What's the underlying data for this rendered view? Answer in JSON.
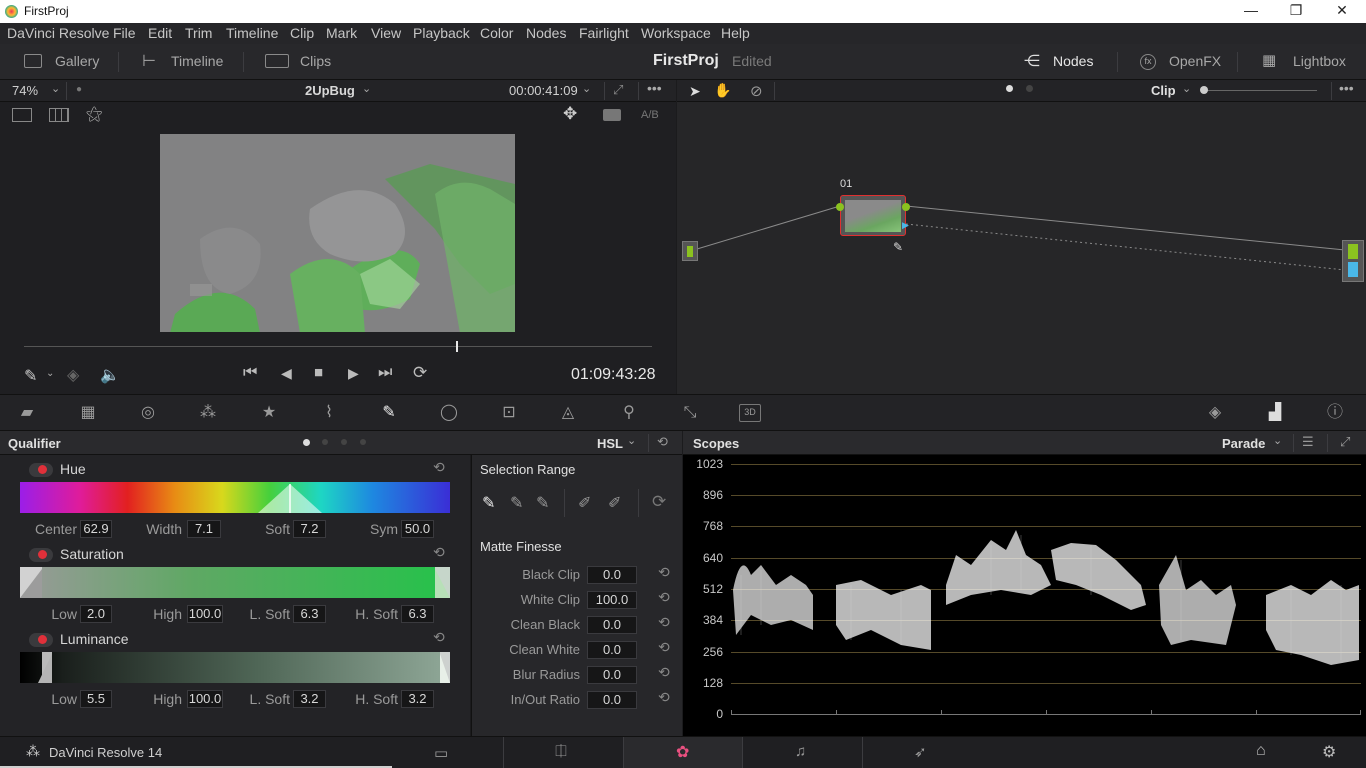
{
  "window": {
    "title": "FirstProj",
    "minimize": "—",
    "restore": "❐",
    "close": "✕"
  },
  "menu": [
    "DaVinci Resolve",
    "File",
    "Edit",
    "Trim",
    "Timeline",
    "Clip",
    "Mark",
    "View",
    "Playback",
    "Color",
    "Nodes",
    "Fairlight",
    "Workspace",
    "Help"
  ],
  "toolbar": {
    "gallery": "Gallery",
    "timeline": "Timeline",
    "clips": "Clips",
    "project": "FirstProj",
    "status": "Edited",
    "nodes": "Nodes",
    "openfx": "OpenFX",
    "lightbox": "Lightbox"
  },
  "viewer": {
    "zoom": "74%",
    "clip_name": "2UpBug",
    "timecode_top": "00:00:41:09",
    "ab_label": "A/B",
    "timecode": "01:09:43:28",
    "playhead_fraction": 0.69
  },
  "nodes": {
    "mode": "Clip",
    "node_label": "01"
  },
  "qualifier": {
    "title": "Qualifier",
    "mode": "HSL",
    "hue": {
      "label": "Hue",
      "center_label": "Center",
      "center": "62.9",
      "width_label": "Width",
      "width": "7.1",
      "soft_label": "Soft",
      "soft": "7.2",
      "sym_label": "Sym",
      "sym": "50.0"
    },
    "saturation": {
      "label": "Saturation",
      "low_label": "Low",
      "low": "2.0",
      "high_label": "High",
      "high": "100.0",
      "lsoft_label": "L. Soft",
      "lsoft": "6.3",
      "hsoft_label": "H. Soft",
      "hsoft": "6.3"
    },
    "luminance": {
      "label": "Luminance",
      "low_label": "Low",
      "low": "5.5",
      "high_label": "High",
      "high": "100.0",
      "lsoft_label": "L. Soft",
      "lsoft": "3.2",
      "hsoft_label": "H. Soft",
      "hsoft": "3.2"
    }
  },
  "selection": {
    "title": "Selection Range",
    "matte_title": "Matte Finesse",
    "rows": [
      {
        "label": "Black Clip",
        "value": "0.0"
      },
      {
        "label": "White Clip",
        "value": "100.0"
      },
      {
        "label": "Clean Black",
        "value": "0.0"
      },
      {
        "label": "Clean White",
        "value": "0.0"
      },
      {
        "label": "Blur Radius",
        "value": "0.0"
      },
      {
        "label": "In/Out Ratio",
        "value": "0.0"
      }
    ]
  },
  "scopes": {
    "title": "Scopes",
    "mode": "Parade",
    "scale": [
      "1023",
      "896",
      "768",
      "640",
      "512",
      "384",
      "256",
      "128",
      "0"
    ]
  },
  "bottom": {
    "app": "DaVinci Resolve 14"
  },
  "colors": {
    "accent_red": "#e0303a",
    "node_green": "#8bc21f",
    "node_blue": "#4ab8e8",
    "background": "#1b1b1d"
  }
}
